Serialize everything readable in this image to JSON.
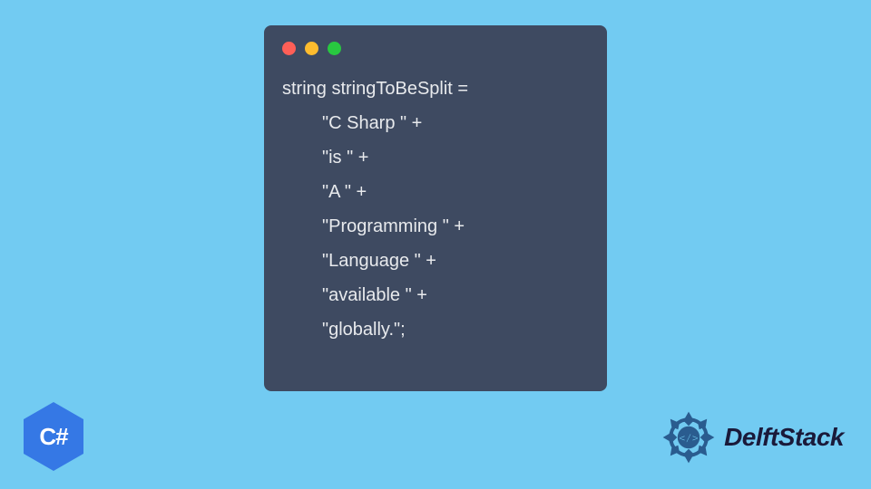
{
  "code": {
    "line1": "string stringToBeSplit =",
    "line2": "\"C Sharp \" +",
    "line3": "\"is \" +",
    "line4": "\"A \" +",
    "line5": "\"Programming \" +",
    "line6": "\"Language \" +",
    "line7": "\"available \" +",
    "line8": "\"globally.\";"
  },
  "logos": {
    "csharp_text": "C#",
    "delft_text": "DelftStack"
  },
  "colors": {
    "background": "#72cbf2",
    "code_bg": "#3e4a61",
    "code_text": "#e8eaed",
    "csharp_blue": "#3578e5",
    "delft_blue": "#2a5c8f"
  }
}
